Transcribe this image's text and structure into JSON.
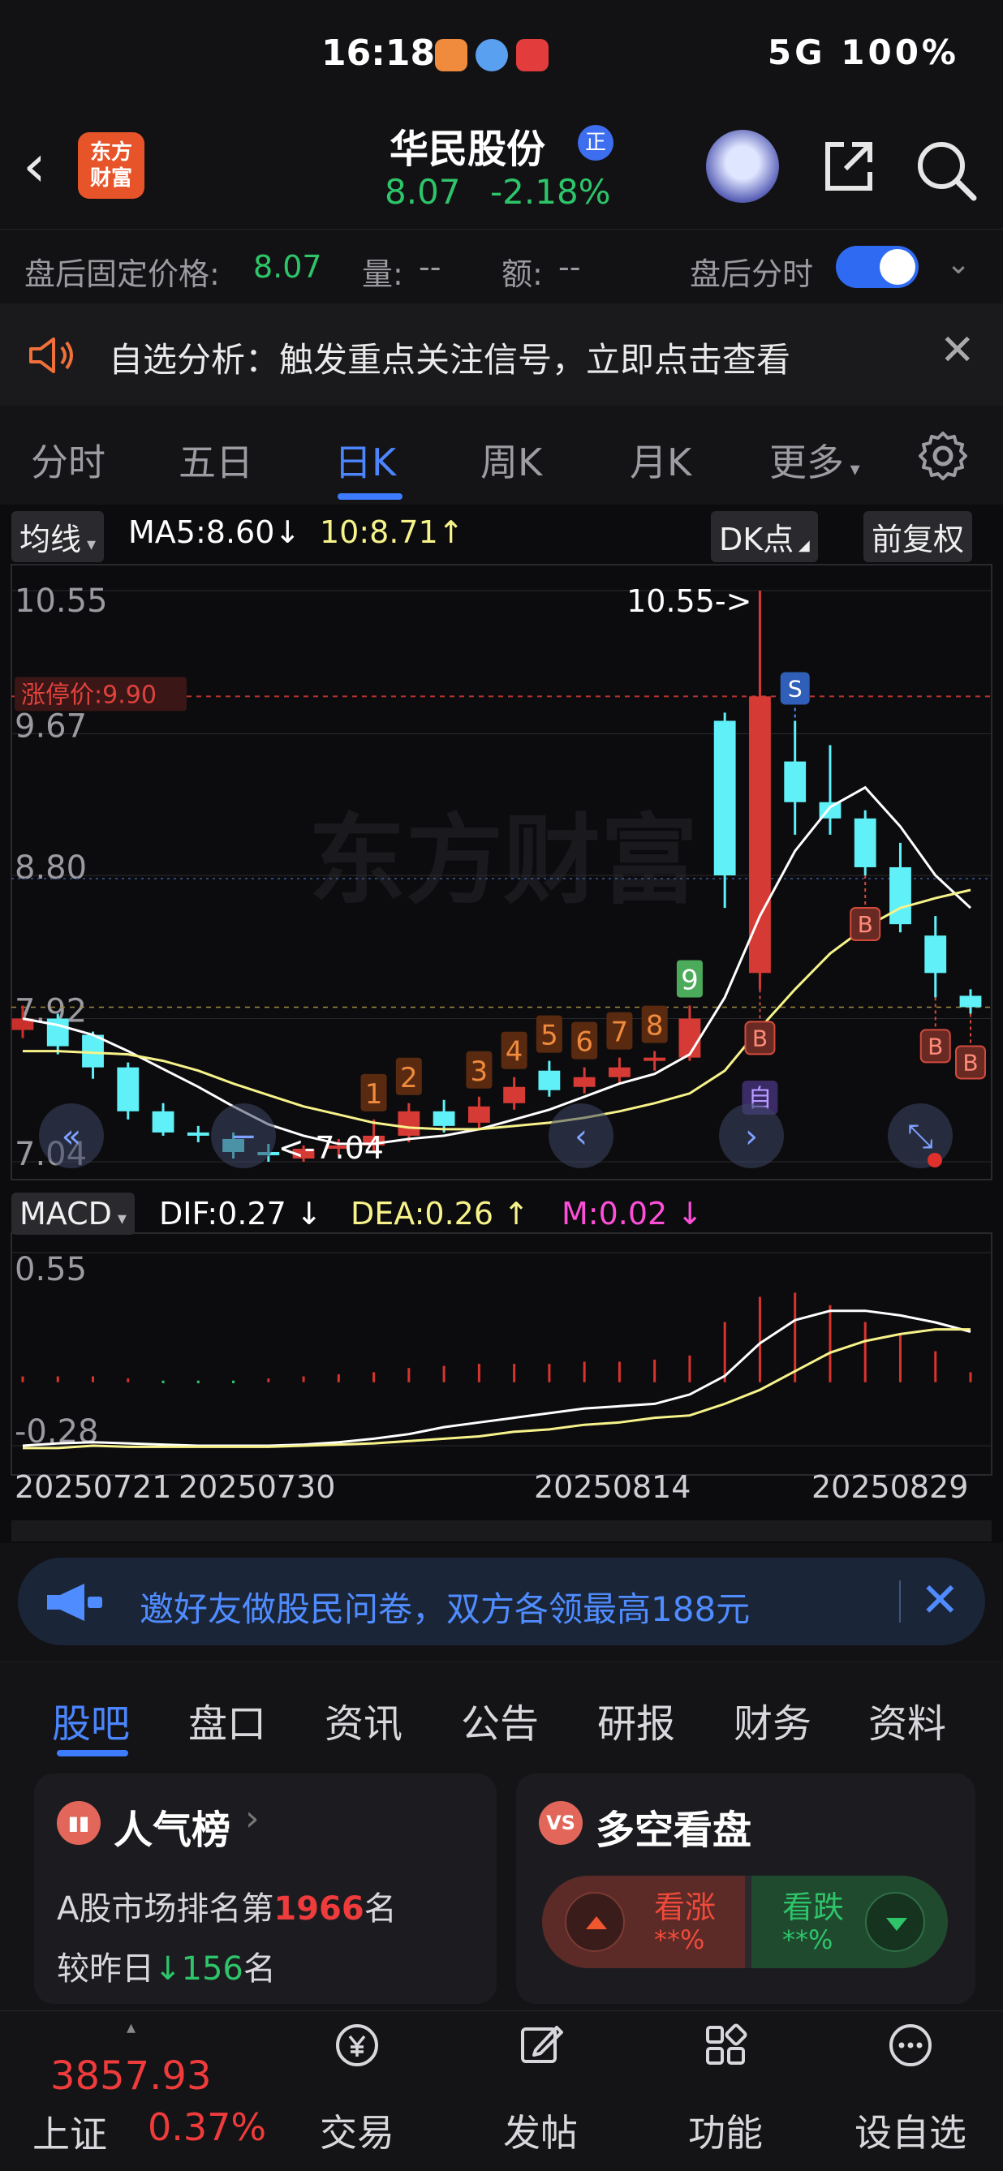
{
  "status": {
    "time": "16:18",
    "right_text": "5G 100%"
  },
  "header": {
    "stock_name": "华民股份",
    "badge": "正",
    "logo_text_1": "东方",
    "logo_text_2": "财富",
    "price": "8.07",
    "change_pct": "-2.18%"
  },
  "postmarket": {
    "fixed_price_label": "盘后固定价格:",
    "fixed_price_value": "8.07",
    "volume_label": "量:",
    "volume_value": "--",
    "amount_label": "额:",
    "amount_value": "--",
    "toggle_label": "盘后分时"
  },
  "notice": {
    "text": "自选分析：触发重点关注信号，立即点击查看"
  },
  "period_tabs": [
    "分时",
    "五日",
    "日K",
    "周K",
    "月K",
    "更多"
  ],
  "active_period": "日K",
  "kline_legend": {
    "chip": "均线",
    "ma5": "MA5:8.60",
    "ma10": "10:8.71",
    "dk": "DK点",
    "fq": "前复权"
  },
  "macd_legend": {
    "chip": "MACD",
    "dif": "DIF:0.27",
    "dea": "DEA:0.26",
    "m": "M:0.02"
  },
  "chart_data": [
    {
      "type": "candlestick",
      "title": "",
      "ylim": [
        7.04,
        10.55
      ],
      "y_ticks": [
        "10.55",
        "9.67",
        "8.80",
        "7.92",
        "7.04"
      ],
      "limit_up_label": "涨停价:9.90",
      "limit_up_value": 9.9,
      "high_annotation": "10.55->",
      "low_annotation": "<-7.04",
      "watermark": "东方财富",
      "x_dates": [
        "20250721",
        "20250730",
        "20250814",
        "20250829"
      ],
      "candles": [
        {
          "o": 7.92,
          "c": 7.85,
          "h": 8.0,
          "l": 7.8,
          "color": "down_red"
        },
        {
          "o": 7.75,
          "c": 7.92,
          "h": 7.95,
          "l": 7.7,
          "color": "cyan"
        },
        {
          "o": 7.62,
          "c": 7.82,
          "h": 7.84,
          "l": 7.55,
          "color": "cyan"
        },
        {
          "o": 7.35,
          "c": 7.62,
          "h": 7.65,
          "l": 7.3,
          "color": "cyan"
        },
        {
          "o": 7.22,
          "c": 7.35,
          "h": 7.4,
          "l": 7.2,
          "color": "cyan"
        },
        {
          "o": 7.2,
          "c": 7.22,
          "h": 7.26,
          "l": 7.16,
          "color": "cyan"
        },
        {
          "o": 7.1,
          "c": 7.18,
          "h": 7.22,
          "l": 7.06,
          "color": "cyan"
        },
        {
          "o": 7.1,
          "c": 7.08,
          "h": 7.15,
          "l": 7.04,
          "color": "cyan"
        },
        {
          "o": 7.06,
          "c": 7.12,
          "h": 7.14,
          "l": 7.04,
          "color": "red"
        },
        {
          "o": 7.12,
          "c": 7.14,
          "h": 7.18,
          "l": 7.08,
          "color": "red"
        },
        {
          "o": 7.14,
          "c": 7.2,
          "h": 7.3,
          "l": 7.1,
          "color": "red"
        },
        {
          "o": 7.2,
          "c": 7.35,
          "h": 7.4,
          "l": 7.16,
          "color": "red"
        },
        {
          "o": 7.35,
          "c": 7.26,
          "h": 7.42,
          "l": 7.22,
          "color": "cyan"
        },
        {
          "o": 7.28,
          "c": 7.38,
          "h": 7.44,
          "l": 7.24,
          "color": "red"
        },
        {
          "o": 7.4,
          "c": 7.5,
          "h": 7.56,
          "l": 7.36,
          "color": "red"
        },
        {
          "o": 7.6,
          "c": 7.48,
          "h": 7.66,
          "l": 7.44,
          "color": "cyan"
        },
        {
          "o": 7.5,
          "c": 7.56,
          "h": 7.62,
          "l": 7.46,
          "color": "red"
        },
        {
          "o": 7.56,
          "c": 7.62,
          "h": 7.68,
          "l": 7.52,
          "color": "red"
        },
        {
          "o": 7.66,
          "c": 7.68,
          "h": 7.72,
          "l": 7.6,
          "color": "red"
        },
        {
          "o": 7.68,
          "c": 7.92,
          "h": 8.0,
          "l": 7.66,
          "color": "red"
        },
        {
          "o": 8.8,
          "c": 9.75,
          "h": 9.8,
          "l": 8.6,
          "color": "cyan"
        },
        {
          "o": 8.2,
          "c": 9.9,
          "h": 10.55,
          "l": 8.1,
          "color": "red"
        },
        {
          "o": 9.25,
          "c": 9.5,
          "h": 9.75,
          "l": 9.05,
          "color": "cyan"
        },
        {
          "o": 9.15,
          "c": 9.25,
          "h": 9.6,
          "l": 9.05,
          "color": "cyan"
        },
        {
          "o": 8.85,
          "c": 9.15,
          "h": 9.2,
          "l": 8.8,
          "color": "cyan"
        },
        {
          "o": 8.5,
          "c": 8.85,
          "h": 9.0,
          "l": 8.45,
          "color": "cyan"
        },
        {
          "o": 8.2,
          "c": 8.43,
          "h": 8.55,
          "l": 8.05,
          "color": "cyan"
        },
        {
          "o": 7.99,
          "c": 8.06,
          "h": 8.1,
          "l": 7.95,
          "color": "cyan"
        }
      ],
      "ma5": [
        7.92,
        7.88,
        7.82,
        7.72,
        7.61,
        7.5,
        7.38,
        7.27,
        7.2,
        7.15,
        7.15,
        7.18,
        7.2,
        7.24,
        7.3,
        7.36,
        7.44,
        7.52,
        7.58,
        7.7,
        8.05,
        8.55,
        8.95,
        9.22,
        9.34,
        9.1,
        8.8,
        8.6
      ],
      "ma10": [
        7.72,
        7.72,
        7.71,
        7.7,
        7.66,
        7.6,
        7.52,
        7.45,
        7.38,
        7.33,
        7.28,
        7.25,
        7.24,
        7.24,
        7.26,
        7.28,
        7.31,
        7.35,
        7.4,
        7.46,
        7.6,
        7.86,
        8.1,
        8.32,
        8.48,
        8.6,
        8.66,
        8.71
      ],
      "signals": [
        {
          "idx": 10,
          "text": "1"
        },
        {
          "idx": 11,
          "text": "2"
        },
        {
          "idx": 13,
          "text": "3"
        },
        {
          "idx": 14,
          "text": "4"
        },
        {
          "idx": 15,
          "text": "5"
        },
        {
          "idx": 16,
          "text": "6"
        },
        {
          "idx": 17,
          "text": "7"
        },
        {
          "idx": 18,
          "text": "8"
        },
        {
          "idx": 19,
          "text": "9"
        }
      ],
      "dk_markers": [
        {
          "idx": 22,
          "text": "S"
        },
        {
          "idx": 21,
          "text": "B"
        },
        {
          "idx": 24,
          "text": "B"
        },
        {
          "idx": 26,
          "text": "B"
        },
        {
          "idx": 27,
          "text": "B"
        }
      ],
      "self_marker": "自"
    },
    {
      "type": "macd",
      "ylim": [
        -0.28,
        0.55
      ],
      "y_ticks": [
        "0.55",
        "-0.28"
      ],
      "hist": [
        0.02,
        0.02,
        0.02,
        0.01,
        -0.005,
        -0.005,
        -0.005,
        0.01,
        0.02,
        0.03,
        0.04,
        0.06,
        0.07,
        0.08,
        0.08,
        0.08,
        0.09,
        0.09,
        0.1,
        0.12,
        0.28,
        0.4,
        0.42,
        0.36,
        0.28,
        0.22,
        0.14,
        0.04
      ],
      "dif": [
        -0.28,
        -0.27,
        -0.265,
        -0.27,
        -0.275,
        -0.28,
        -0.28,
        -0.28,
        -0.275,
        -0.265,
        -0.25,
        -0.23,
        -0.2,
        -0.18,
        -0.16,
        -0.14,
        -0.12,
        -0.11,
        -0.1,
        -0.06,
        0.02,
        0.16,
        0.26,
        0.3,
        0.3,
        0.28,
        0.25,
        0.21
      ],
      "dea": [
        -0.29,
        -0.29,
        -0.28,
        -0.285,
        -0.285,
        -0.285,
        -0.285,
        -0.285,
        -0.28,
        -0.275,
        -0.27,
        -0.26,
        -0.25,
        -0.24,
        -0.22,
        -0.21,
        -0.19,
        -0.18,
        -0.16,
        -0.15,
        -0.1,
        -0.04,
        0.04,
        0.12,
        0.17,
        0.2,
        0.22,
        0.22
      ]
    }
  ],
  "invite_banner": {
    "text": "邀好友做股民问卷，双方各领最高188元"
  },
  "info_tabs": [
    "股吧",
    "盘口",
    "资讯",
    "公告",
    "研报",
    "财务",
    "资料"
  ],
  "active_info_tab": "股吧",
  "popularity_card": {
    "title": "人气榜",
    "line1_prefix": "A股市场排名第",
    "rank": "1966",
    "line1_suffix": "名",
    "line2_prefix": "较昨日",
    "change": "156",
    "line2_suffix": "名"
  },
  "sentiment_card": {
    "title": "多空看盘",
    "up_label": "看涨",
    "up_value": "**%",
    "down_label": "看跌",
    "down_value": "**%"
  },
  "bottom_nav": {
    "index_price": "3857.93",
    "index_name": "上证",
    "index_pct": "0.37%",
    "items": [
      "交易",
      "发帖",
      "功能",
      "设自选"
    ]
  },
  "colors": {
    "up_red": "#ef3b3b",
    "down_green": "#2ec46a",
    "kline_cyan": "#5ff0f8",
    "accent_blue": "#3d7bff",
    "ma5_white": "#ffffff",
    "ma10_yellow": "#f7f38a",
    "macd_magenta": "#ff4fd8"
  }
}
